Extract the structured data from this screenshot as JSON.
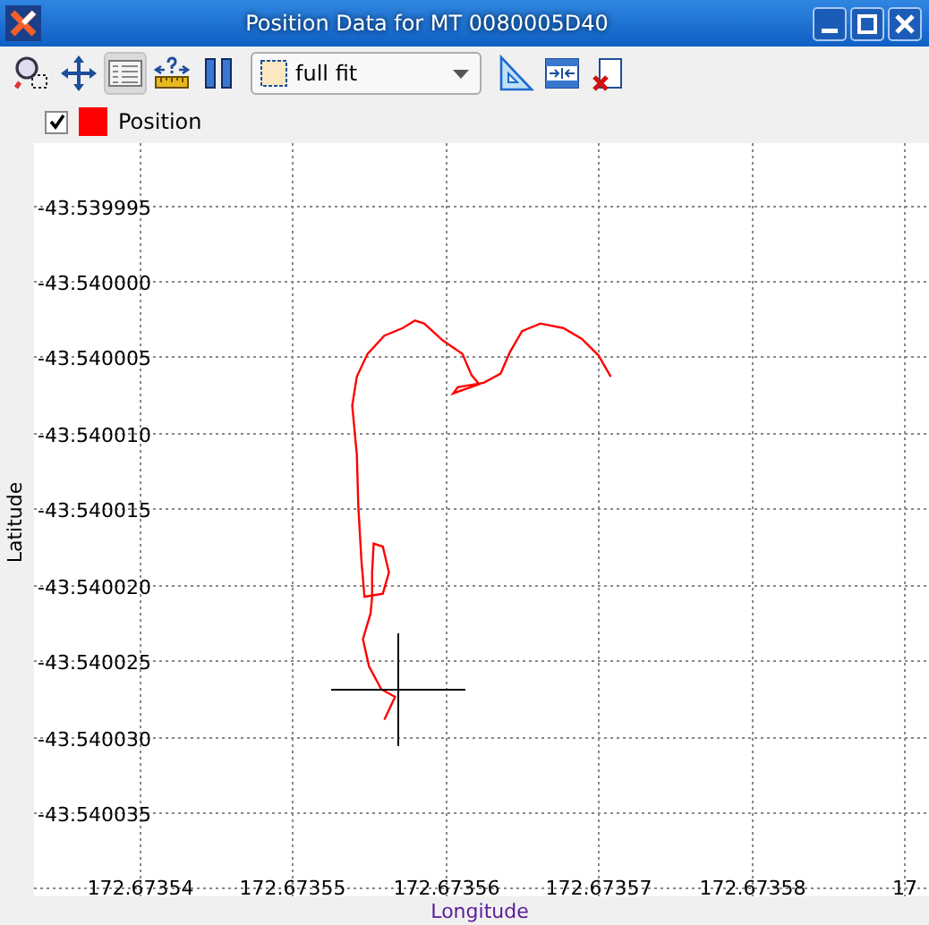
{
  "window": {
    "title": "Position Data for MT 0080005D40"
  },
  "toolbar": {
    "tools": [
      {
        "kind": "zoom",
        "pressed": false
      },
      {
        "kind": "pan",
        "pressed": false
      },
      {
        "kind": "table",
        "pressed": true
      },
      {
        "kind": "measure",
        "pressed": false
      },
      {
        "kind": "pause",
        "pressed": false
      }
    ],
    "fit_dropdown": {
      "value": "full fit"
    },
    "tools_after": [
      {
        "kind": "ruler",
        "pressed": false
      },
      {
        "kind": "columns",
        "pressed": false
      },
      {
        "kind": "remove",
        "pressed": false
      }
    ]
  },
  "legend": [
    {
      "checked": true
    }
  ],
  "plot": {
    "edge_tick_label": "17",
    "chart_data": {
      "type": "line",
      "grid": true,
      "xlabel": "Longitude",
      "ylabel": "Latitude",
      "x": [
        172.673556,
        172.6735567,
        172.6735558,
        172.673555,
        172.6735546,
        172.6735551,
        172.6735552,
        172.6735552,
        172.6735553,
        172.6735559,
        172.6735563,
        172.6735559,
        172.6735547,
        172.6735545,
        172.6735543,
        172.6735542,
        172.6735539,
        172.6735542,
        172.6735549,
        172.673556,
        172.6735572,
        172.673558,
        172.6735586,
        172.6735598,
        172.6735611,
        172.6735617,
        172.6735622,
        172.6735605,
        172.6735608,
        172.6735625,
        172.6735636,
        172.6735642,
        172.673565,
        172.6735662,
        172.6735677,
        172.6735689,
        172.67357,
        172.6735708
      ],
      "series": [
        {
          "name": "Position",
          "color": "#ff0000",
          "values": [
            -43.5400289,
            -43.5400274,
            -43.5400269,
            -43.5400254,
            -43.5400236,
            -43.5400219,
            -43.5400208,
            -43.5400192,
            -43.5400173,
            -43.5400175,
            -43.5400192,
            -43.5400206,
            -43.5400208,
            -43.5400184,
            -43.5400149,
            -43.5400114,
            -43.5400082,
            -43.5400063,
            -43.5400048,
            -43.5400036,
            -43.5400031,
            -43.5400026,
            -43.5400028,
            -43.5400039,
            -43.5400048,
            -43.5400062,
            -43.5400068,
            -43.5400074,
            -43.540007,
            -43.5400067,
            -43.5400061,
            -43.5400047,
            -43.5400033,
            -43.5400028,
            -43.5400031,
            -43.5400038,
            -43.5400049,
            -43.5400063
          ]
        }
      ],
      "xlim": [
        172.6735331,
        172.6735916
      ],
      "ylim": [
        -43.54004055,
        -43.53999091
      ],
      "xticks": [
        172.67354,
        172.67355,
        172.67356,
        172.67357,
        172.67358
      ],
      "yticks": [
        {
          "value": -43.539995,
          "label": "-43.539995"
        },
        {
          "value": -43.54,
          "label": "-43.540000"
        },
        {
          "value": -43.540005,
          "label": "-43.540005"
        },
        {
          "value": -43.54001,
          "label": "-43.540010"
        },
        {
          "value": -43.540015,
          "label": "-43.540015"
        },
        {
          "value": -43.54002,
          "label": "-43.540020"
        },
        {
          "value": -43.540025,
          "label": "-43.540025"
        },
        {
          "value": -43.54003,
          "label": "-43.540030"
        },
        {
          "value": -43.540035,
          "label": "-43.540035"
        }
      ]
    }
  }
}
